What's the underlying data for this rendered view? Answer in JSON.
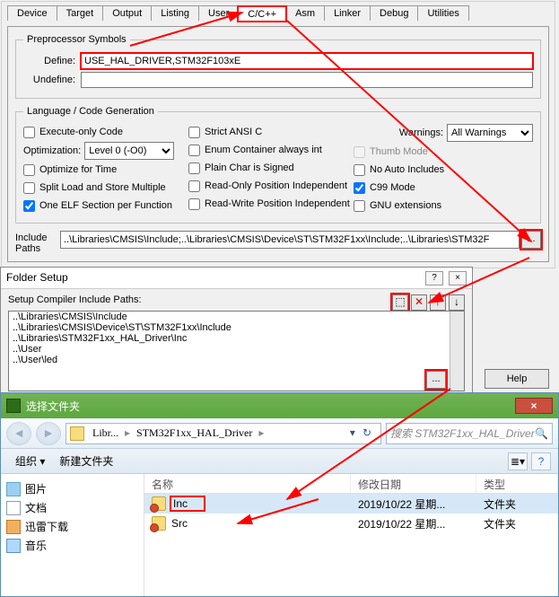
{
  "tabs": [
    "Device",
    "Target",
    "Output",
    "Listing",
    "User",
    "C/C++",
    "Asm",
    "Linker",
    "Debug",
    "Utilities"
  ],
  "active_tab": "C/C++",
  "preproc": {
    "legend": "Preprocessor Symbols",
    "define_label": "Define:",
    "define_value": "USE_HAL_DRIVER,STM32F103xE",
    "undefine_label": "Undefine:",
    "undefine_value": ""
  },
  "langgen": {
    "legend": "Language / Code Generation",
    "execute_only": "Execute-only Code",
    "optimization_label": "Optimization:",
    "optimization_value": "Level 0 (-O0)",
    "optimize_time": "Optimize for Time",
    "split_load": "Split Load and Store Multiple",
    "one_elf": "One ELF Section per Function",
    "strict_ansi": "Strict ANSI C",
    "enum_int": "Enum Container always int",
    "plain_char": "Plain Char is Signed",
    "ro_pi": "Read-Only Position Independent",
    "rw_pi": "Read-Write Position Independent",
    "warnings_label": "Warnings:",
    "warnings_value": "All Warnings",
    "thumb": "Thumb Mode",
    "no_auto": "No Auto Includes",
    "c99": "C99 Mode",
    "gnu": "GNU extensions"
  },
  "include": {
    "label": "Include\nPaths",
    "value": "..\\Libraries\\CMSIS\\Include;..\\Libraries\\CMSIS\\Device\\ST\\STM32F1xx\\Include;..\\Libraries\\STM32F",
    "dots": "..."
  },
  "help_label": "Help",
  "folder_setup": {
    "title": "Folder Setup",
    "question": "?",
    "close": "×",
    "label": "Setup Compiler Include Paths:",
    "tool_new": "⬚",
    "tool_del": "✕",
    "tool_up": "↑",
    "tool_down": "↓",
    "paths": [
      "..\\Libraries\\CMSIS\\Include",
      "..\\Libraries\\CMSIS\\Device\\ST\\STM32F1xx\\Include",
      "..\\Libraries\\STM32F1xx_HAL_Driver\\Inc",
      "..\\User",
      "..\\User\\led"
    ],
    "dots": "..."
  },
  "explorer": {
    "title": "选择文件夹",
    "close": "×",
    "breadcrumb": [
      "Libr...",
      "STM32F1xx_HAL_Driver"
    ],
    "refresh": "↻",
    "search_placeholder": "搜索 STM32F1xx_HAL_Driver",
    "search_icon": "🔍",
    "toolbar": {
      "org": "组织 ▾",
      "newfolder": "新建文件夹"
    },
    "tree": [
      {
        "icon": "pic",
        "label": "图片"
      },
      {
        "icon": "doc",
        "label": "文档"
      },
      {
        "icon": "dl",
        "label": "迅雷下载"
      },
      {
        "icon": "music",
        "label": "音乐"
      }
    ],
    "columns": {
      "name": "名称",
      "date": "修改日期",
      "type": "类型"
    },
    "rows": [
      {
        "name": "Inc",
        "date": "2019/10/22 星期...",
        "type": "文件夹",
        "sel": true
      },
      {
        "name": "Src",
        "date": "2019/10/22 星期...",
        "type": "文件夹",
        "sel": false
      }
    ]
  }
}
